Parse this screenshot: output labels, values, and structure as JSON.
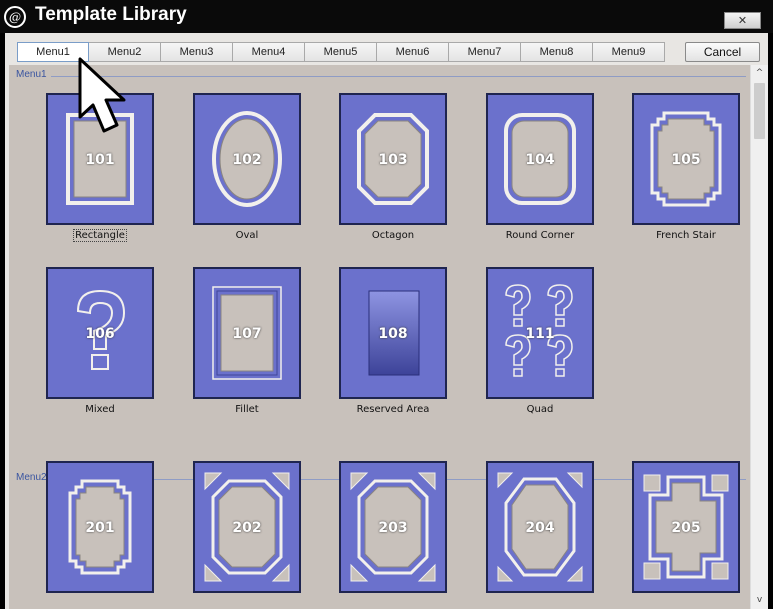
{
  "window": {
    "title": "Template Library",
    "logo_glyph": "@",
    "close_glyph": "✕"
  },
  "tabs": [
    "Menu1",
    "Menu2",
    "Menu3",
    "Menu4",
    "Menu5",
    "Menu6",
    "Menu7",
    "Menu8",
    "Menu9"
  ],
  "active_tab": "Menu1",
  "cancel_label": "Cancel",
  "scroll": {
    "up_glyph": "^",
    "down_glyph": "v"
  },
  "sections": [
    {
      "label": "Menu1",
      "items": [
        {
          "number": "101",
          "caption": "Rectangle",
          "shape": "rectangle",
          "selected": true
        },
        {
          "number": "102",
          "caption": "Oval",
          "shape": "oval"
        },
        {
          "number": "103",
          "caption": "Octagon",
          "shape": "octagon"
        },
        {
          "number": "104",
          "caption": "Round Corner",
          "shape": "round-corner"
        },
        {
          "number": "105",
          "caption": "French Stair",
          "shape": "french-stair"
        },
        {
          "number": "106",
          "caption": "Mixed",
          "shape": "question-mark"
        },
        {
          "number": "107",
          "caption": "Fillet",
          "shape": "fillet"
        },
        {
          "number": "108",
          "caption": "Reserved Area",
          "shape": "reserved-area"
        },
        {
          "number": "111",
          "caption": "Quad",
          "shape": "quad-question"
        }
      ]
    },
    {
      "label": "Menu2",
      "items": [
        {
          "number": "201",
          "caption": "",
          "shape": "stair"
        },
        {
          "number": "202",
          "caption": "",
          "shape": "octagon-corners"
        },
        {
          "number": "203",
          "caption": "",
          "shape": "octagon-corners"
        },
        {
          "number": "204",
          "caption": "",
          "shape": "hex-corners"
        },
        {
          "number": "205",
          "caption": "",
          "shape": "cross"
        }
      ]
    }
  ],
  "colors": {
    "thumb_fill": "#6b71cc",
    "shape_fill": "#c8c1bb",
    "shape_edge": "#f2f0ec",
    "content_bg": "#c8c1bb",
    "section_label": "#3a55a0"
  }
}
